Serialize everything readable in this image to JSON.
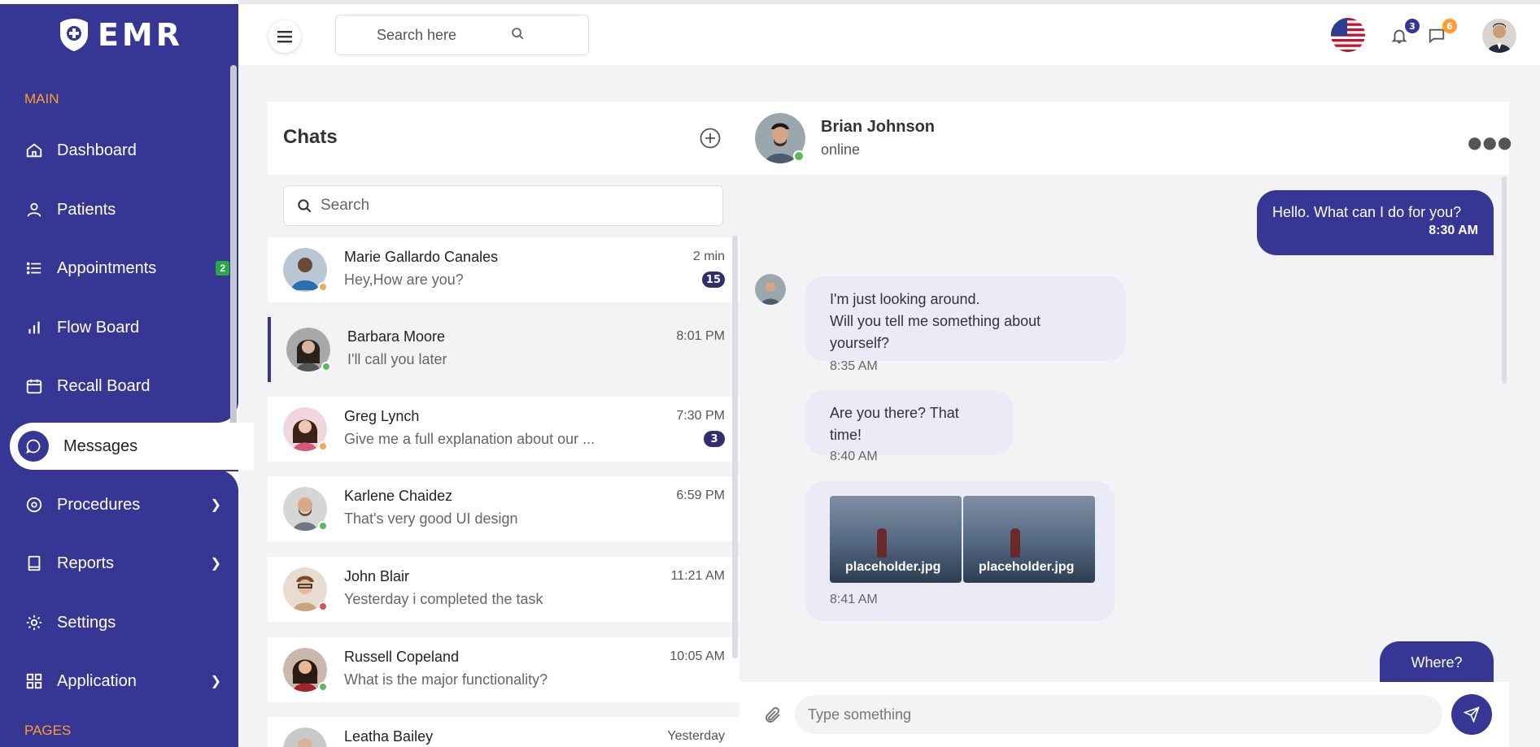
{
  "brand": {
    "name": "EMR"
  },
  "sidebar": {
    "section_main": "MAIN",
    "section_pages": "PAGES",
    "items": [
      {
        "label": "Dashboard",
        "icon": "home-icon"
      },
      {
        "label": "Patients",
        "icon": "user-icon"
      },
      {
        "label": "Appointments",
        "icon": "list-icon",
        "badge": "2"
      },
      {
        "label": "Flow Board",
        "icon": "bar-chart-icon"
      },
      {
        "label": "Recall Board",
        "icon": "calendar-icon"
      },
      {
        "label": "Messages",
        "icon": "chat-bubble-icon",
        "active": true
      },
      {
        "label": "Procedures",
        "icon": "target-icon",
        "chevron": true
      },
      {
        "label": "Reports",
        "icon": "book-icon",
        "chevron": true
      },
      {
        "label": "Settings",
        "icon": "gear-icon"
      },
      {
        "label": "Application",
        "icon": "grid-icon",
        "chevron": true
      }
    ]
  },
  "header": {
    "search_placeholder": "Search here",
    "notifications_count": "3",
    "messages_count": "6"
  },
  "chat_list": {
    "title": "Chats",
    "search_placeholder": "Search",
    "conversations": [
      {
        "name": "Marie Gallardo Canales",
        "message": "Hey,How are you?",
        "time": "2 min",
        "unread": "15",
        "status": "away"
      },
      {
        "name": "Barbara Moore",
        "message": "I'll call you later",
        "time": "8:01 PM",
        "status": "online",
        "active": true
      },
      {
        "name": "Greg Lynch",
        "message": "Give me a full explanation about our ...",
        "time": "7:30 PM",
        "unread": "3",
        "status": "away"
      },
      {
        "name": "Karlene Chaidez",
        "message": "That's very good UI design",
        "time": "6:59 PM",
        "status": "online"
      },
      {
        "name": "John Blair",
        "message": "Yesterday i completed the task",
        "time": "11:21 AM",
        "status": "busy"
      },
      {
        "name": "Russell Copeland",
        "message": "What is the major functionality?",
        "time": "10:05 AM",
        "status": "online"
      },
      {
        "name": "Leatha Bailey",
        "message": "",
        "time": "Yesterday",
        "status": "online"
      }
    ]
  },
  "chat_panel": {
    "contact_name": "Brian Johnson",
    "contact_status": "online",
    "messages": [
      {
        "dir": "out",
        "lines": [
          "Hello. What can I do for you?"
        ],
        "time": "8:30 AM"
      },
      {
        "dir": "in",
        "lines": [
          "I'm just looking around.",
          "Will you tell me something about yourself?"
        ],
        "time": "8:35 AM"
      },
      {
        "dir": "in",
        "lines": [
          "Are you there? That time!"
        ],
        "time": "8:40 AM"
      },
      {
        "dir": "in",
        "attachments": [
          "placeholder.jpg",
          "placeholder.jpg"
        ],
        "time": "8:41 AM"
      },
      {
        "dir": "out",
        "lines": [
          "Where?"
        ]
      }
    ],
    "composer_placeholder": "Type something"
  },
  "colors": {
    "primary": "#363795",
    "accent_orange": "#ff9b2f",
    "online": "#5cb85c",
    "away": "#f0ad4e",
    "busy": "#d9534f",
    "badge_green": "#28a745"
  }
}
